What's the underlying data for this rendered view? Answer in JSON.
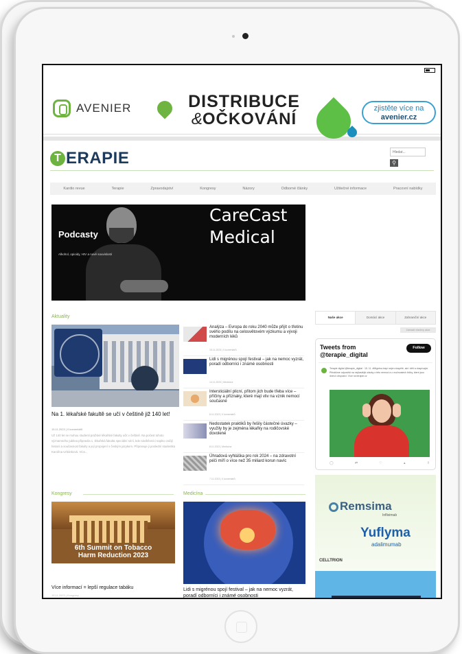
{
  "ad": {
    "brand": "AVENIER",
    "headline_1": "DISTRIBUCE",
    "headline_amp": "&",
    "headline_2": "OČKOVÁNÍ",
    "cta_line1": "zjistěte více na",
    "cta_line2": "avenier.cz",
    "colors": {
      "green": "#6fb440",
      "blue": "#3aa0d0"
    }
  },
  "site": {
    "logo_letter": "T",
    "logo_text": "ERAPIE",
    "search_placeholder": "Hledat...",
    "search_icon": "search-icon"
  },
  "nav": {
    "items": [
      "Kardio revue",
      "Terapie",
      "Zpravodajství",
      "Kongresy",
      "Názory",
      "Odborné články",
      "Užitečné informace",
      "Pracovní nabídky"
    ]
  },
  "hero": {
    "label": "Podcasty",
    "sub": "Alkohol, opioidy, HIV a nové souvislosti",
    "brand_1": "CareCast",
    "brand_2": "Medical"
  },
  "aktuality": {
    "title": "Aktuality",
    "feature": {
      "title": "Na 1. lékařské fakultě se učí v češtině již 140 let!",
      "meta": "15.11.2023 | 0 komentářů",
      "excerpt": "Už 140 let se mohou studenti pražské lékařské fakulty učit v češtině. Na počest tohoto významného jubilea připravila 1. lékařská fakulta speciální sérii, kde návštěvníci naplno zažijí historii a současnost fakulty a její propojení s českým jazykem. Připravuje ji poslední studentka Karolína Urbánková. Více..."
    },
    "articles": [
      {
        "title": "Analýza – Evropa do roku 2040 může přijít o třetinu svého podílu na celosvětovém výzkumu a vývoji moderních léků",
        "meta": "15.11.2023 | 0 komentářů"
      },
      {
        "title": "Lidi s migrénou spojí festival – jak na nemoc vyzrát, poradí odborníci i známé osobnosti",
        "meta": "14.11.2023 | Medicína"
      },
      {
        "title": "Intersticiální plicní, přitom jich bude třeba více – příčiny a příznaky, které mají vliv na vznik nemocí současné",
        "meta": "8.11.2023 | 0 komentářů"
      },
      {
        "title": "Nedostatek praktiků by řešily částečné úvazky – využily by je zejména lékařky na rodičovské dovolené",
        "meta": "8.11.2023 | Medicína"
      },
      {
        "title": "Úhradová vyhláška pro rok 2024 – na zdravotní péči míří o více než 35 miliard korun navíc",
        "meta": "7.11.2023 | 0 komentářů"
      }
    ]
  },
  "sidebar": {
    "tabs": [
      "Naše akce",
      "Domácí akce",
      "Zahraniční akce"
    ],
    "more_link": "Zobrazit všechny akce",
    "twitter": {
      "title_1": "Tweets from",
      "title_2": "@terapie_digital",
      "follow": "Follow",
      "tweet": "Terapie digital @terapie_digital · 15. 11. #Migréna trápí nejen dospělé, ale i děti a dospívající. Přinášíme odpovědi na nejčastější otázky o této nemoci a o možnostech léčby, které jsou dnes k dispozici. Více na terapie.cz",
      "actions": [
        "reply-icon",
        "retweet-icon",
        "like-icon",
        "views-icon",
        "share-icon"
      ]
    },
    "ad": {
      "brand_1": "Remsima",
      "brand_1_sub": "Infliximab",
      "brand_2": "Yuflyma",
      "brand_2_sub": "adalimumab",
      "company": "CELLTRION"
    }
  },
  "kongresy": {
    "title": "Kongresy",
    "card_text_1": "6th Summit on Tobacco",
    "card_text_2": "Harm Reduction 2023",
    "caption": "Více informací = lepší regulace tabáku",
    "meta": "15.11.2023 | Kongresy"
  },
  "medicina": {
    "title": "Medicína",
    "caption": "Lidi s migrénou spojí festival – jak na nemoc vyzrát, poradí odborníci i známé osobnosti"
  }
}
